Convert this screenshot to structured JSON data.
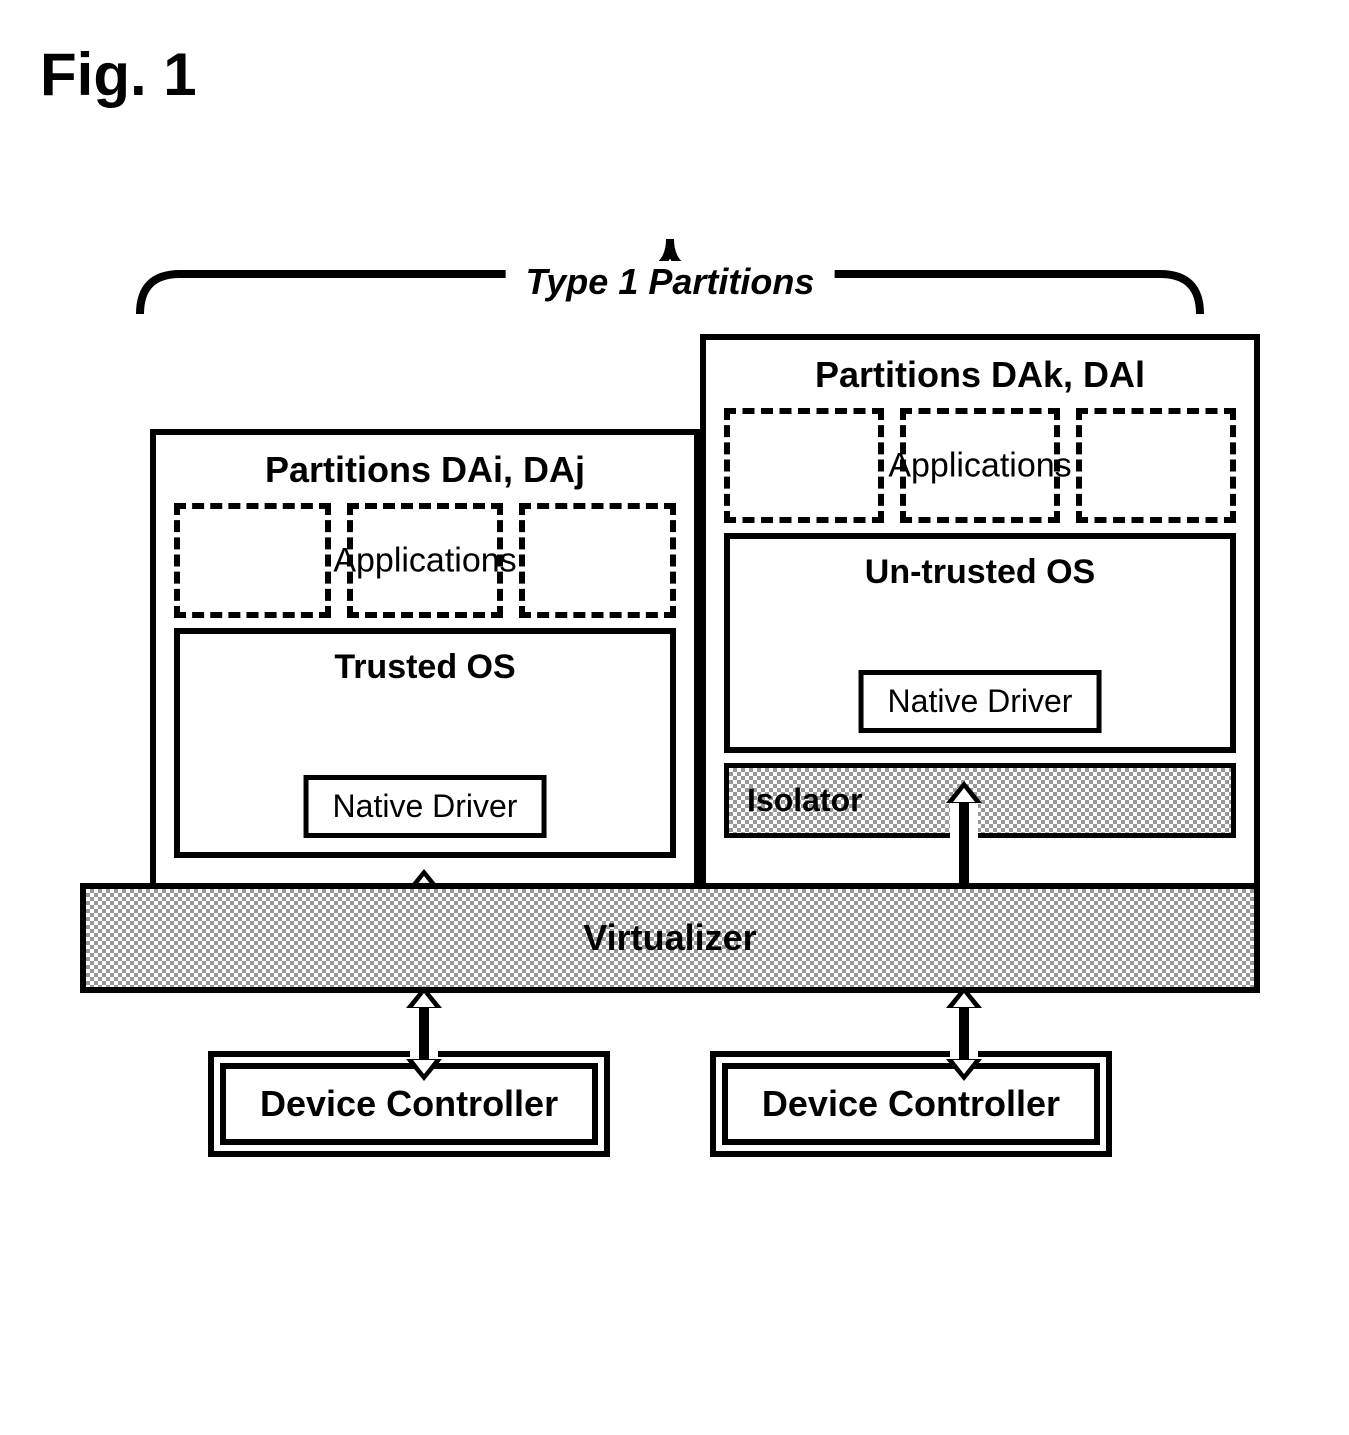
{
  "figure_title": "Fig. 1",
  "bracket_label": "Type 1 Partitions",
  "partition_left": {
    "title": "Partitions DAi, DAj",
    "apps_label": "Applications",
    "os_title": "Trusted OS",
    "driver_label": "Native Driver"
  },
  "partition_right": {
    "title": "Partitions DAk, DAl",
    "apps_label": "Applications",
    "os_title": "Un-trusted OS",
    "driver_label": "Native Driver",
    "isolator_label": "Isolator"
  },
  "virtualizer_label": "Virtualizer",
  "controller_left": "Device Controller",
  "controller_right": "Device Controller"
}
